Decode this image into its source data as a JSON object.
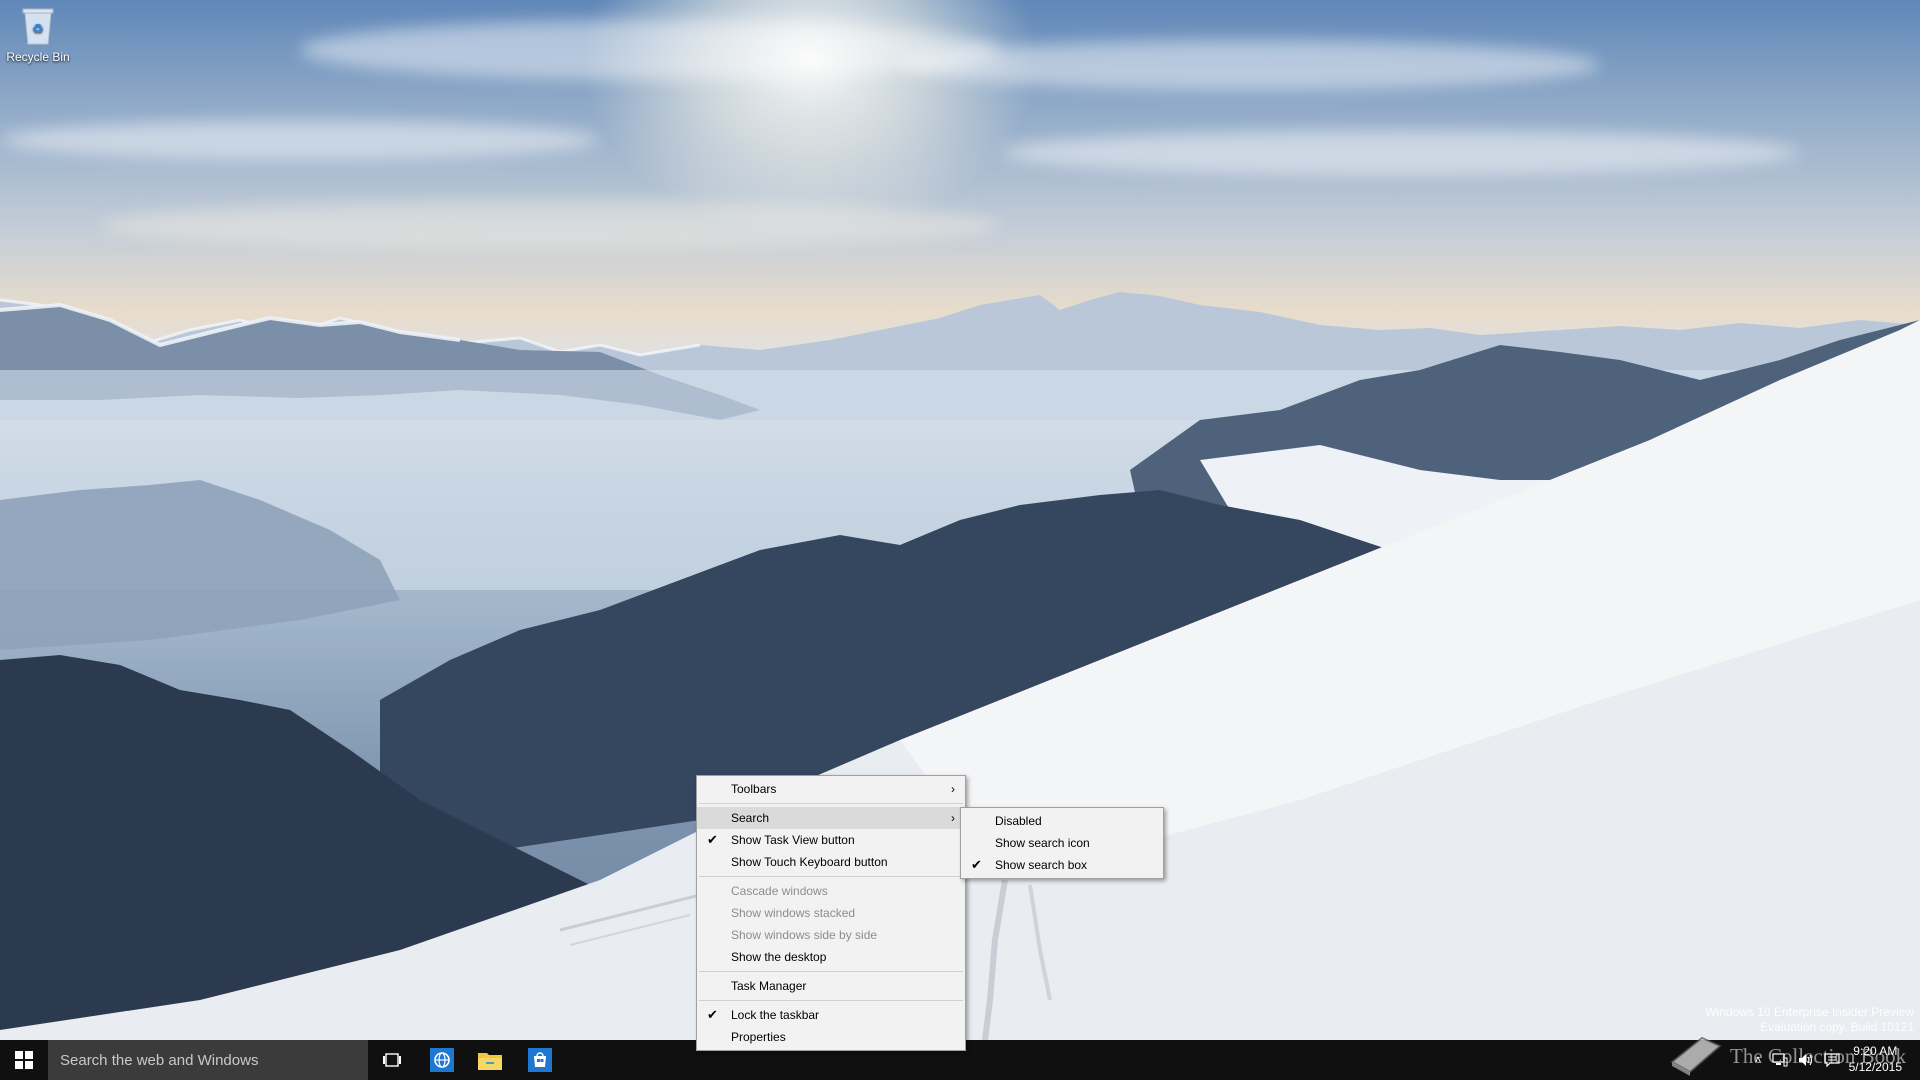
{
  "desktop": {
    "recycle_bin_label": "Recycle Bin"
  },
  "watermark": {
    "line1": "Windows 10 Enterprise Insider Preview",
    "line2": "Evaluation copy. Build 10121",
    "brand": "The Collection Book"
  },
  "taskbar": {
    "search_placeholder": "Search the web and Windows",
    "clock_time": "9:20 AM",
    "clock_date": "5/12/2015",
    "tray_chevron": "˄"
  },
  "context_menu": {
    "items": [
      {
        "label": "Toolbars",
        "checked": false,
        "submenu": true,
        "disabled": false
      },
      {
        "label": "Search",
        "checked": false,
        "submenu": true,
        "disabled": false,
        "highlighted": true
      },
      {
        "label": "Show Task View button",
        "checked": true,
        "submenu": false,
        "disabled": false
      },
      {
        "label": "Show Touch Keyboard button",
        "checked": false,
        "submenu": false,
        "disabled": false
      },
      {
        "label": "Cascade windows",
        "checked": false,
        "submenu": false,
        "disabled": true
      },
      {
        "label": "Show windows stacked",
        "checked": false,
        "submenu": false,
        "disabled": true
      },
      {
        "label": "Show windows side by side",
        "checked": false,
        "submenu": false,
        "disabled": true
      },
      {
        "label": "Show the desktop",
        "checked": false,
        "submenu": false,
        "disabled": false
      },
      {
        "label": "Task Manager",
        "checked": false,
        "submenu": false,
        "disabled": false
      },
      {
        "label": "Lock the taskbar",
        "checked": true,
        "submenu": false,
        "disabled": false
      },
      {
        "label": "Properties",
        "checked": false,
        "submenu": false,
        "disabled": false
      }
    ],
    "check_glyph": "✔",
    "arrow_glyph": "›"
  },
  "search_submenu": {
    "items": [
      {
        "label": "Disabled",
        "checked": false
      },
      {
        "label": "Show search icon",
        "checked": false
      },
      {
        "label": "Show search box",
        "checked": true
      }
    ]
  },
  "icons": {
    "start": "windows-logo-icon",
    "task_view": "task-view-icon",
    "edge": "edge-browser-icon",
    "explorer": "file-explorer-icon",
    "store": "store-icon",
    "network": "network-icon",
    "volume": "volume-icon",
    "action_center": "action-center-icon"
  },
  "colors": {
    "taskbar": "#101010",
    "search_box": "#3b3b3b",
    "menu_bg": "#f2f2f2",
    "menu_highlight": "#dadada",
    "accent": "#1e78d2"
  }
}
